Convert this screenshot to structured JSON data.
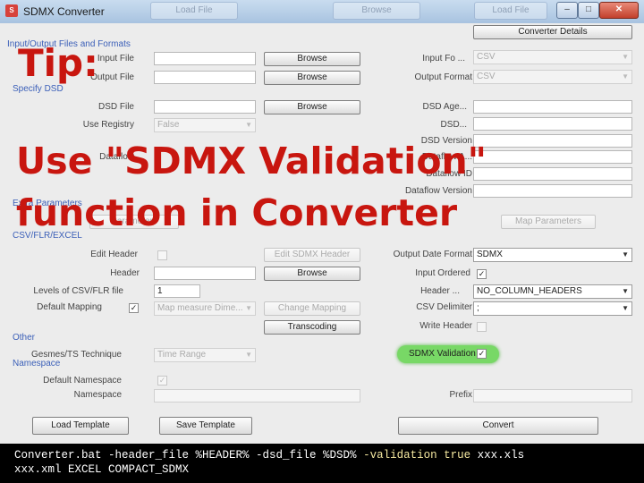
{
  "window": {
    "title": "SDMX Converter",
    "app_icon": "sdmx-app-icon",
    "ghost_tabs": [
      "Load File",
      "Browse",
      "Load File"
    ],
    "controls": {
      "minimize": "–",
      "maximize": "□",
      "close": "✕"
    }
  },
  "toolbar": {
    "converter_details": "Converter Details"
  },
  "sections": {
    "io": "Input/Output Files and Formats",
    "dsd": "Specify DSD",
    "params": "Extra Parameters",
    "csv": "CSV/FLR/EXCEL",
    "other": "Other",
    "namespace": "Namespace"
  },
  "io": {
    "input_file_label": "Input File",
    "output_file_label": "Output File",
    "browse": "Browse",
    "input_format_label": "Input Fo ...",
    "input_format_value": "CSV",
    "output_format_label": "Output Format",
    "output_format_value": "CSV"
  },
  "dsd": {
    "dsd_file_label": "DSD File",
    "browse": "Browse",
    "use_registry_label": "Use Registry",
    "use_registry_value": "False",
    "dataflow_label": "Dataflow",
    "dsd_agency_label": "DSD Age...",
    "dsd_id_label": "DSD...",
    "dsd_version_label": "DSD Version",
    "dataflow_agency_label": "Dataflow A...",
    "dataflow_id_label": "Dataflow ID",
    "dataflow_version_label": "Dataflow Version"
  },
  "params": {
    "left_button": "Parameters",
    "right_button": "Map Parameters"
  },
  "csv": {
    "edit_header_label": "Edit Header",
    "edit_sdmx_header": "Edit SDMX Header",
    "header_label": "Header",
    "browse": "Browse",
    "levels_label": "Levels of CSV/FLR file",
    "levels_value": "1",
    "default_mapping_label": "Default Mapping",
    "default_mapping_checked": "✓",
    "mapping_combo": "Map measure Dime...",
    "change_mapping": "Change Mapping",
    "transcoding": "Transcoding",
    "output_date_format_label": "Output Date Format",
    "output_date_format_value": "SDMX",
    "input_ordered_label": "Input Ordered",
    "input_ordered_checked": "✓",
    "header_row_label": "Header ...",
    "header_row_value": "NO_COLUMN_HEADERS",
    "csv_delimiter_label": "CSV Delimiter",
    "csv_delimiter_value": ";",
    "write_header_label": "Write Header"
  },
  "other": {
    "gesmes_label": "Gesmes/TS Technique",
    "gesmes_value": "Time Range",
    "sdmx_validation_label": "SDMX Validation",
    "sdmx_validation_checked": "✓"
  },
  "namespace": {
    "default_namespace_label": "Default Namespace",
    "default_namespace_checked": "✓",
    "namespace_label": "Namespace",
    "prefix_label": "Prefix"
  },
  "footer": {
    "load_template": "Load Template",
    "save_template": "Save Template",
    "convert": "Convert"
  },
  "overlay": {
    "tip": "Tip:",
    "line1": "Use \"SDMX Validation\"",
    "line2": "function in Converter",
    "color": "#c8160f"
  },
  "command": {
    "line1_pre": "Converter.bat -header_file %HEADER% -dsd_file %DSD% ",
    "line1_highlight": "-validation true",
    "line1_post": " xxx.xls",
    "line2": "xxx.xml EXCEL COMPACT_SDMX",
    "highlight_color": "#f5e8a0"
  }
}
